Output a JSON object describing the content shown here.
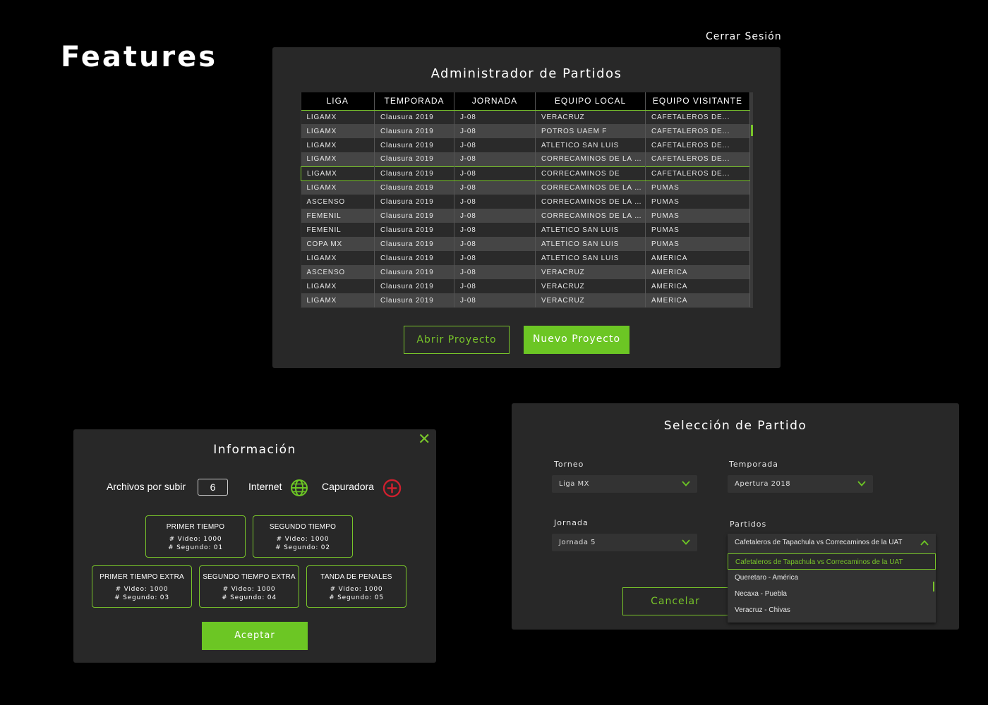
{
  "page": {
    "title": "Features",
    "logout_label": "Cerrar Sesión"
  },
  "colors": {
    "accent": "#78c42a",
    "accent_fill": "#6cc624",
    "panel": "#282828",
    "danger": "#d0202e"
  },
  "admin": {
    "title": "Administrador de Partidos",
    "columns": [
      "LIGA",
      "TEMPORADA",
      "JORNADA",
      "EQUIPO LOCAL",
      "EQUIPO VISITANTE"
    ],
    "rows": [
      [
        "LIGAMX",
        "Clausura 2019",
        "J-08",
        "VERACRUZ",
        "CAFETALEROS DE..."
      ],
      [
        "LIGAMX",
        "Clausura 2019",
        "J-08",
        "POTROS UAEM F",
        "CAFETALEROS DE..."
      ],
      [
        "LIGAMX",
        "Clausura 2019",
        "J-08",
        "ATLETICO SAN LUIS",
        "CAFETALEROS DE..."
      ],
      [
        "LIGAMX",
        "Clausura 2019",
        "J-08",
        "CORRECAMINOS DE LA UAT",
        "CAFETALEROS DE..."
      ],
      [
        "LIGAMX",
        "Clausura 2019",
        "J-08",
        "CORRECAMINOS DE",
        "CAFETALEROS DE..."
      ],
      [
        "LIGAMX",
        "Clausura 2019",
        "J-08",
        "CORRECAMINOS DE LA UAT",
        "PUMAS"
      ],
      [
        "ASCENSO",
        "Clausura 2019",
        "J-08",
        "CORRECAMINOS DE LA UAT",
        "PUMAS"
      ],
      [
        "FEMENIL",
        "Clausura 2019",
        "J-08",
        "CORRECAMINOS DE LA UAT",
        "PUMAS"
      ],
      [
        "FEMENIL",
        "Clausura 2019",
        "J-08",
        "ATLETICO SAN LUIS",
        "PUMAS"
      ],
      [
        "COPA MX",
        "Clausura 2019",
        "J-08",
        "ATLETICO SAN LUIS",
        "PUMAS"
      ],
      [
        "LIGAMX",
        "Clausura 2019",
        "J-08",
        "ATLETICO SAN LUIS",
        "AMERICA"
      ],
      [
        "ASCENSO",
        "Clausura 2019",
        "J-08",
        "VERACRUZ",
        "AMERICA"
      ],
      [
        "LIGAMX",
        "Clausura 2019",
        "J-08",
        "VERACRUZ",
        "AMERICA"
      ],
      [
        "LIGAMX",
        "Clausura 2019",
        "J-08",
        "VERACRUZ",
        "AMERICA"
      ]
    ],
    "selected_row": 4,
    "open_button": "Abrir Proyecto",
    "new_button": "Nuevo Proyecto"
  },
  "info": {
    "title": "Información",
    "close_icon": "close-icon",
    "files_label": "Archivos por subir",
    "files_count": "6",
    "internet_label": "Internet",
    "internet_icon": "globe-icon",
    "capture_label": "Capuradora",
    "capture_icon": "plus-circle-icon",
    "periods": [
      {
        "title": "PRIMER TIEMPO",
        "video": "# Video: 1000",
        "segment": "# Segundo: 01"
      },
      {
        "title": "SEGUNDO TIEMPO",
        "video": "# Video: 1000",
        "segment": "# Segundo: 02"
      },
      {
        "title": "PRIMER TIEMPO EXTRA",
        "video": "# Video: 1000",
        "segment": "# Segundo: 03"
      },
      {
        "title": "SEGUNDO TIEMPO EXTRA",
        "video": "# Video: 1000",
        "segment": "# Segundo: 04"
      },
      {
        "title": "TANDA DE PENALES",
        "video": "# Video: 1000",
        "segment": "# Segundo: 05"
      }
    ],
    "accept_button": "Aceptar"
  },
  "selection": {
    "title": "Selección de Partido",
    "torneo_label": "Torneo",
    "torneo_value": "Liga MX",
    "temporada_label": "Temporada",
    "temporada_value": "Apertura 2018",
    "jornada_label": "Jornada",
    "jornada_value": "Jornada 5",
    "partidos_label": "Partidos",
    "partidos_value": "Cafetaleros de Tapachula vs Correcaminos de la UAT",
    "partidos_options": [
      "Cafetaleros de Tapachula vs Correcaminos de la UAT",
      "Queretaro - América",
      "Necaxa - Puebla",
      "Veracruz - Chivas"
    ],
    "cancel_button": "Cancelar"
  }
}
